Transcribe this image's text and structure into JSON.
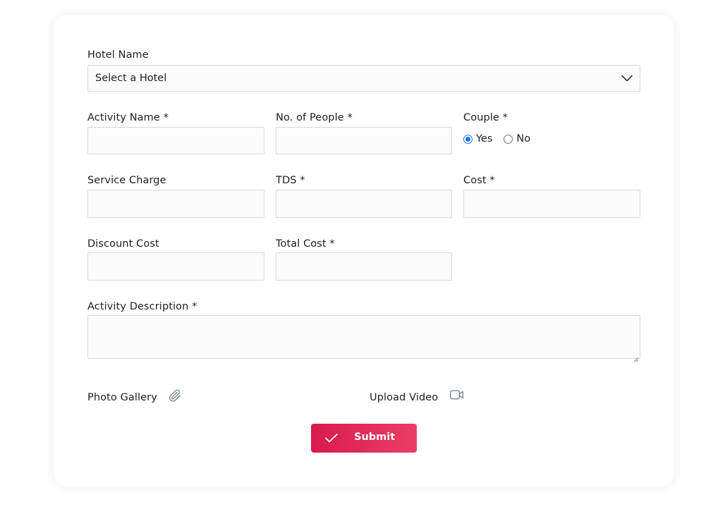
{
  "form": {
    "hotel": {
      "label": "Hotel Name",
      "selected": "Select a Hotel"
    },
    "activity_name": {
      "label": "Activity Name *",
      "value": ""
    },
    "people": {
      "label": "No. of People *",
      "value": ""
    },
    "couple": {
      "label": "Couple *",
      "options": [
        {
          "label": "Yes",
          "checked": true
        },
        {
          "label": "No",
          "checked": false
        }
      ]
    },
    "service_charge": {
      "label": "Service Charge",
      "value": ""
    },
    "tds": {
      "label": "TDS *",
      "value": ""
    },
    "cost": {
      "label": "Cost *",
      "value": ""
    },
    "discount_cost": {
      "label": "Discount Cost",
      "value": ""
    },
    "total_cost": {
      "label": "Total Cost *",
      "value": ""
    },
    "description": {
      "label": "Activity Description *",
      "value": ""
    },
    "photo_gallery": {
      "label": "Photo Gallery",
      "icon": "paperclip-icon"
    },
    "upload_video": {
      "label": "Upload Video",
      "icon": "video-camera-icon"
    },
    "submit": {
      "label": "Submit",
      "icon": "checkmark-icon"
    }
  },
  "colors": {
    "submit_gradient_start": "#d81b4f",
    "submit_gradient_end": "#ea3e66",
    "radio_accent": "#1a73e8",
    "icon_color": "#7a8a9a"
  }
}
